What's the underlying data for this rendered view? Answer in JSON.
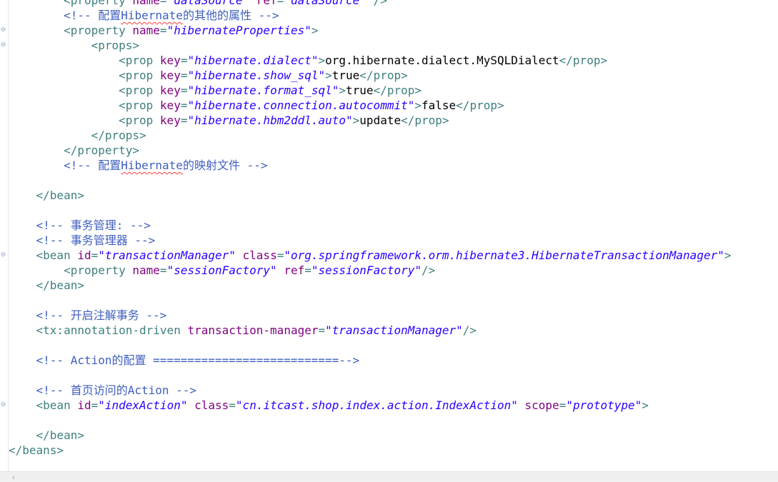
{
  "editor": {
    "lines": [
      {
        "indent": "        ",
        "parts": [
          {
            "t": "tag",
            "v": "<property "
          },
          {
            "t": "attr",
            "v": "name"
          },
          {
            "t": "tag",
            "v": "="
          },
          {
            "t": "val",
            "v": "\"dataSource\""
          },
          {
            "t": "tag",
            "v": " "
          },
          {
            "t": "attr",
            "v": "ref"
          },
          {
            "t": "tag",
            "v": "="
          },
          {
            "t": "val",
            "v": "\"dataSource\""
          },
          {
            "t": "tag",
            "v": " />"
          }
        ]
      },
      {
        "indent": "        ",
        "parts": [
          {
            "t": "cmt",
            "v": "<!-- 配置"
          },
          {
            "t": "cmt-sq",
            "v": "Hibernate"
          },
          {
            "t": "cmt",
            "v": "的其他的属性 -->"
          }
        ]
      },
      {
        "indent": "        ",
        "fold": true,
        "parts": [
          {
            "t": "tag",
            "v": "<property "
          },
          {
            "t": "attr",
            "v": "name"
          },
          {
            "t": "tag",
            "v": "="
          },
          {
            "t": "val",
            "v": "\"hibernateProperties\""
          },
          {
            "t": "tag",
            "v": ">"
          }
        ]
      },
      {
        "indent": "            ",
        "fold": true,
        "parts": [
          {
            "t": "tag",
            "v": "<props>"
          }
        ]
      },
      {
        "indent": "                ",
        "parts": [
          {
            "t": "tag",
            "v": "<prop "
          },
          {
            "t": "attr",
            "v": "key"
          },
          {
            "t": "tag",
            "v": "="
          },
          {
            "t": "val",
            "v": "\"hibernate.dialect\""
          },
          {
            "t": "tag",
            "v": ">"
          },
          {
            "t": "txt",
            "v": "org.hibernate.dialect.MySQLDialect"
          },
          {
            "t": "tag",
            "v": "</prop>"
          }
        ]
      },
      {
        "indent": "                ",
        "parts": [
          {
            "t": "tag",
            "v": "<prop "
          },
          {
            "t": "attr",
            "v": "key"
          },
          {
            "t": "tag",
            "v": "="
          },
          {
            "t": "val",
            "v": "\"hibernate.show_sql\""
          },
          {
            "t": "tag",
            "v": ">"
          },
          {
            "t": "txt",
            "v": "true"
          },
          {
            "t": "tag",
            "v": "</prop>"
          }
        ]
      },
      {
        "indent": "                ",
        "parts": [
          {
            "t": "tag",
            "v": "<prop "
          },
          {
            "t": "attr",
            "v": "key"
          },
          {
            "t": "tag",
            "v": "="
          },
          {
            "t": "val",
            "v": "\"hibernate.format_sql\""
          },
          {
            "t": "tag",
            "v": ">"
          },
          {
            "t": "txt",
            "v": "true"
          },
          {
            "t": "tag",
            "v": "</prop>"
          }
        ]
      },
      {
        "indent": "                ",
        "parts": [
          {
            "t": "tag",
            "v": "<prop "
          },
          {
            "t": "attr",
            "v": "key"
          },
          {
            "t": "tag",
            "v": "="
          },
          {
            "t": "val",
            "v": "\"hibernate.connection.autocommit\""
          },
          {
            "t": "tag",
            "v": ">"
          },
          {
            "t": "txt",
            "v": "false"
          },
          {
            "t": "tag",
            "v": "</prop>"
          }
        ]
      },
      {
        "indent": "                ",
        "parts": [
          {
            "t": "tag",
            "v": "<prop "
          },
          {
            "t": "attr",
            "v": "key"
          },
          {
            "t": "tag",
            "v": "="
          },
          {
            "t": "val",
            "v": "\"hibernate.hbm2ddl.auto\""
          },
          {
            "t": "tag",
            "v": ">"
          },
          {
            "t": "txt",
            "v": "update"
          },
          {
            "t": "tag",
            "v": "</prop>"
          }
        ]
      },
      {
        "indent": "            ",
        "parts": [
          {
            "t": "tag",
            "v": "</props>"
          }
        ]
      },
      {
        "indent": "        ",
        "parts": [
          {
            "t": "tag",
            "v": "</property>"
          }
        ]
      },
      {
        "indent": "        ",
        "parts": [
          {
            "t": "cmt",
            "v": "<!-- 配置"
          },
          {
            "t": "cmt-sq",
            "v": "Hibernate"
          },
          {
            "t": "cmt",
            "v": "的映射文件 -->"
          }
        ]
      },
      {
        "indent": "",
        "parts": []
      },
      {
        "indent": "    ",
        "parts": [
          {
            "t": "tag",
            "v": "</bean>"
          }
        ]
      },
      {
        "indent": "",
        "parts": []
      },
      {
        "indent": "    ",
        "parts": [
          {
            "t": "cmt",
            "v": "<!-- 事务管理: -->"
          }
        ]
      },
      {
        "indent": "    ",
        "parts": [
          {
            "t": "cmt",
            "v": "<!-- 事务管理器 -->"
          }
        ]
      },
      {
        "indent": "    ",
        "fold": true,
        "parts": [
          {
            "t": "tag",
            "v": "<bean "
          },
          {
            "t": "attr",
            "v": "id"
          },
          {
            "t": "tag",
            "v": "="
          },
          {
            "t": "val",
            "v": "\"transactionManager\""
          },
          {
            "t": "tag",
            "v": " "
          },
          {
            "t": "attr",
            "v": "class"
          },
          {
            "t": "tag",
            "v": "="
          },
          {
            "t": "val",
            "v": "\"org.springframework.orm.hibernate3.HibernateTransactionManager\""
          },
          {
            "t": "tag",
            "v": ">"
          }
        ]
      },
      {
        "indent": "        ",
        "parts": [
          {
            "t": "tag",
            "v": "<property "
          },
          {
            "t": "attr",
            "v": "name"
          },
          {
            "t": "tag",
            "v": "="
          },
          {
            "t": "val",
            "v": "\"sessionFactory\""
          },
          {
            "t": "tag",
            "v": " "
          },
          {
            "t": "attr",
            "v": "ref"
          },
          {
            "t": "tag",
            "v": "="
          },
          {
            "t": "val",
            "v": "\"sessionFactory\""
          },
          {
            "t": "tag",
            "v": "/>"
          }
        ]
      },
      {
        "indent": "    ",
        "parts": [
          {
            "t": "tag",
            "v": "</bean>"
          }
        ]
      },
      {
        "indent": "",
        "parts": []
      },
      {
        "indent": "    ",
        "parts": [
          {
            "t": "cmt",
            "v": "<!-- 开启注解事务 -->"
          }
        ]
      },
      {
        "indent": "    ",
        "parts": [
          {
            "t": "tag",
            "v": "<tx:annotation-driven "
          },
          {
            "t": "attr",
            "v": "transaction-manager"
          },
          {
            "t": "tag",
            "v": "="
          },
          {
            "t": "val",
            "v": "\"transactionManager\""
          },
          {
            "t": "tag",
            "v": "/>"
          }
        ]
      },
      {
        "indent": "",
        "parts": []
      },
      {
        "indent": "    ",
        "parts": [
          {
            "t": "cmt",
            "v": "<!-- Action的配置 ===========================-->"
          }
        ]
      },
      {
        "indent": "",
        "parts": []
      },
      {
        "indent": "    ",
        "parts": [
          {
            "t": "cmt",
            "v": "<!-- 首页访问的Action -->"
          }
        ]
      },
      {
        "indent": "    ",
        "fold": true,
        "parts": [
          {
            "t": "tag",
            "v": "<bean "
          },
          {
            "t": "attr",
            "v": "id"
          },
          {
            "t": "tag",
            "v": "="
          },
          {
            "t": "val",
            "v": "\"indexAction\""
          },
          {
            "t": "tag",
            "v": " "
          },
          {
            "t": "attr",
            "v": "class"
          },
          {
            "t": "tag",
            "v": "="
          },
          {
            "t": "val",
            "v": "\"cn.itcast.shop.index.action.IndexAction\""
          },
          {
            "t": "tag",
            "v": " "
          },
          {
            "t": "attr",
            "v": "scope"
          },
          {
            "t": "tag",
            "v": "="
          },
          {
            "t": "val",
            "v": "\"prototype\""
          },
          {
            "t": "tag",
            "v": ">"
          }
        ]
      },
      {
        "indent": "",
        "parts": []
      },
      {
        "indent": "    ",
        "parts": [
          {
            "t": "tag",
            "v": "</bean>"
          }
        ]
      },
      {
        "indent": "",
        "parts": [
          {
            "t": "tag",
            "v": "</beans>"
          }
        ]
      }
    ],
    "fold_icon": "collapse-minus-icon"
  },
  "scrollbar": {
    "left_arrow": "‹",
    "left_arrow_icon": "chevron-left-icon"
  },
  "colors": {
    "tag": "#3f7f7f",
    "attribute": "#7f007f",
    "attribute_value": "#2a00ff",
    "comment": "#3f5fbf",
    "text": "#000000",
    "spell_error": "#ff3b3b"
  }
}
